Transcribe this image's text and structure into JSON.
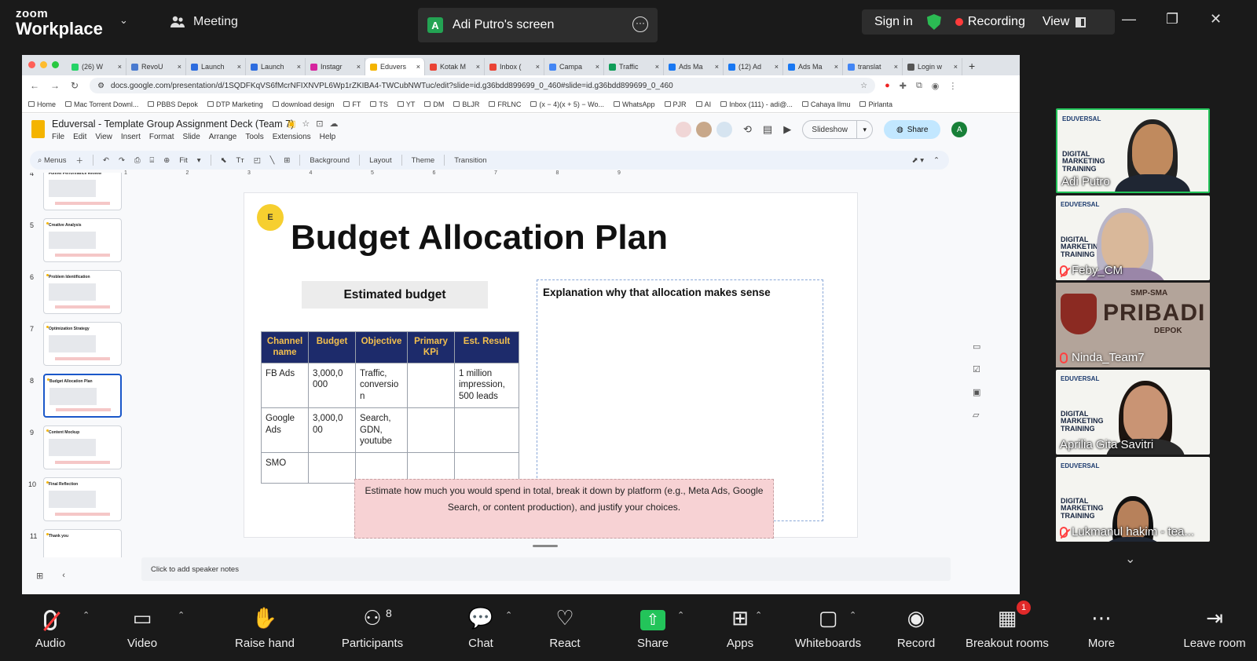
{
  "zoom": {
    "logo_line1": "zoom",
    "logo_line2": "Workplace",
    "meeting_label": "Meeting",
    "share_avatar": "A",
    "share_title": "Adi Putro's screen",
    "sign_in": "Sign in",
    "recording": "Recording",
    "view": "View",
    "accent_green": "#23a353",
    "record_red": "#ff3b3b"
  },
  "browser": {
    "tabs": [
      {
        "label": "(26) W",
        "color": "#25d366"
      },
      {
        "label": "RevoU",
        "color": "#4a7bd0"
      },
      {
        "label": "Launch",
        "color": "#2d6cdf"
      },
      {
        "label": "Launch",
        "color": "#2d6cdf"
      },
      {
        "label": "Instagr",
        "color": "#d6249f"
      },
      {
        "label": "Eduvers",
        "color": "#f4b400"
      },
      {
        "label": "Kotak M",
        "color": "#ea4335"
      },
      {
        "label": "Inbox (",
        "color": "#ea4335"
      },
      {
        "label": "Campa",
        "color": "#4285f4"
      },
      {
        "label": "Traffic",
        "color": "#0f9d58"
      },
      {
        "label": "Ads Ma",
        "color": "#1877f2"
      },
      {
        "label": "(12) Ad",
        "color": "#1877f2"
      },
      {
        "label": "Ads Ma",
        "color": "#1877f2"
      },
      {
        "label": "translat",
        "color": "#4285f4"
      },
      {
        "label": "Login w",
        "color": "#555555"
      }
    ],
    "url": "docs.google.com/presentation/d/1SQDFKqVS6fMcrNFIXNVPL6Wp1rZKIBA4-TWCubNWTuc/edit?slide=id.g36bdd899699_0_460#slide=id.g36bdd899699_0_460",
    "bookmarks": [
      "Home",
      "Mac Torrent Downl...",
      "PBBS Depok",
      "DTP Marketing",
      "download design",
      "FT",
      "TS",
      "YT",
      "DM",
      "BLJR",
      "FRLNC",
      "(x − 4)(x + 5) − Wo...",
      "WhatsApp",
      "PJR",
      "AI",
      "Inbox (111) - adi@...",
      "Cahaya Ilmu",
      "Pirlanta"
    ]
  },
  "slides_app": {
    "doc_title": "Eduversal - Template Group Assignment Deck (Team 7)",
    "menu": [
      "File",
      "Edit",
      "View",
      "Insert",
      "Format",
      "Slide",
      "Arrange",
      "Tools",
      "Extensions",
      "Help"
    ],
    "menus_search": "Menus",
    "zoom_value": "Fit",
    "toolbar_buttons": [
      "Background",
      "Layout",
      "Theme",
      "Transition"
    ],
    "slideshow_label": "Slideshow",
    "share_label": "Share",
    "account_initial": "A",
    "speaker_notes_placeholder": "Click to add speaker notes",
    "ruler_ticks": [
      "1",
      "2",
      "3",
      "4",
      "5",
      "6",
      "7",
      "8",
      "9"
    ],
    "thumbnails": [
      {
        "num": "4",
        "title": "Funnel Performance Review"
      },
      {
        "num": "5",
        "title": "Creative Analysis"
      },
      {
        "num": "6",
        "title": "Problem Identification"
      },
      {
        "num": "7",
        "title": "Optimization Strategy"
      },
      {
        "num": "8",
        "title": "Budget Allocation Plan"
      },
      {
        "num": "9",
        "title": "Content Mockup"
      },
      {
        "num": "10",
        "title": "Final Reflection"
      },
      {
        "num": "11",
        "title": "Thank you"
      }
    ]
  },
  "slide": {
    "title": "Budget Allocation Plan",
    "logo_text": "E",
    "estimated_budget": "Estimated budget",
    "explanation_heading": "Explanation why that allocation makes sense",
    "table": {
      "headers": [
        "Channel name",
        "Budget",
        "Objective",
        "Primary KPi",
        "Est. Result"
      ],
      "rows": [
        [
          "FB Ads",
          "3,000,0 000",
          "Traffic, conversio n",
          "",
          "1 million impression, 500 leads"
        ],
        [
          "Google Ads",
          "3,000,0 00",
          "Search, GDN, youtube",
          "",
          ""
        ],
        [
          "SMO",
          "",
          "",
          "",
          ""
        ]
      ]
    },
    "instruction": "Estimate how much you would spend in total, break it down by platform (e.g., Meta Ads, Google Search, or content production), and justify your choices."
  },
  "participants": [
    {
      "name": "Adi Putro",
      "muted": false
    },
    {
      "name": "Feby_CM",
      "muted": true
    },
    {
      "name": "Ninda_Team7",
      "muted": true
    },
    {
      "name": "Aprilia Gita Savitri",
      "muted": false
    },
    {
      "name": "Lukmanul hakim - tea...",
      "muted": true
    }
  ],
  "banner": {
    "line1": "EDUVERSAL",
    "line2": "DIGITAL MARKETING TRAINING",
    "sign": "PRIBADI",
    "sign_top": "SMP-SMA",
    "sign_bottom": "DEPOK"
  },
  "controls": [
    {
      "label": "Audio",
      "icon": "mic-muted-icon"
    },
    {
      "label": "Video",
      "icon": "camera-icon"
    },
    {
      "label": "Raise hand",
      "icon": "hand-icon"
    },
    {
      "label": "Participants",
      "icon": "people-icon",
      "count": "8"
    },
    {
      "label": "Chat",
      "icon": "chat-icon"
    },
    {
      "label": "React",
      "icon": "heart-icon"
    },
    {
      "label": "Share",
      "icon": "share-icon"
    },
    {
      "label": "Apps",
      "icon": "apps-icon"
    },
    {
      "label": "Whiteboards",
      "icon": "whiteboard-icon"
    },
    {
      "label": "Record",
      "icon": "record-icon"
    },
    {
      "label": "Breakout rooms",
      "icon": "breakout-icon",
      "badge": "1"
    },
    {
      "label": "More",
      "icon": "more-icon"
    },
    {
      "label": "Leave room",
      "icon": "leave-icon"
    }
  ]
}
